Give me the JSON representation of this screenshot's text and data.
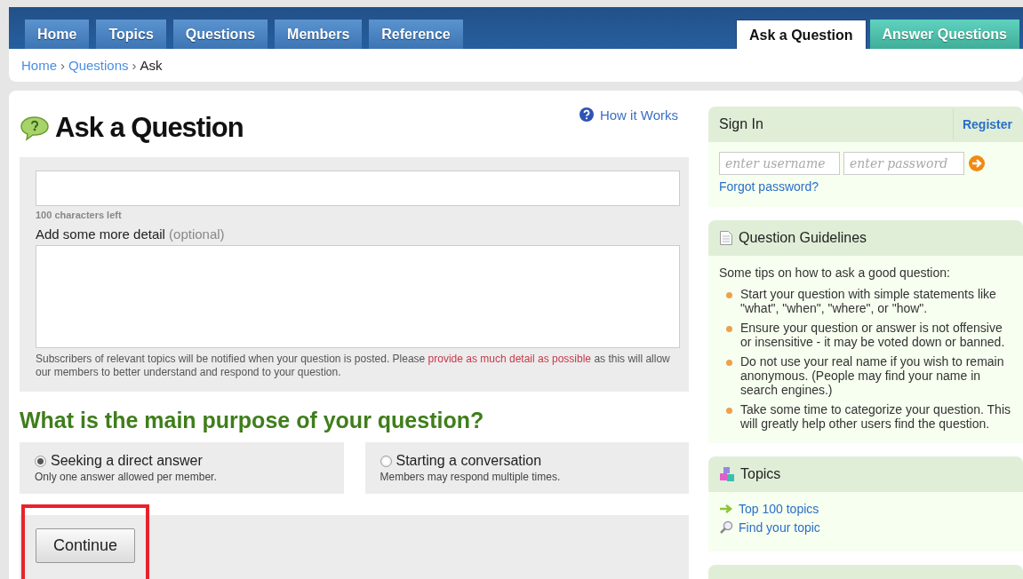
{
  "nav": {
    "tabs": [
      {
        "label": "Home"
      },
      {
        "label": "Topics"
      },
      {
        "label": "Questions"
      },
      {
        "label": "Members"
      },
      {
        "label": "Reference"
      }
    ],
    "actions": [
      {
        "label": "Ask a Question",
        "kind": "ask",
        "selected": true
      },
      {
        "label": "Answer Questions",
        "kind": "answer",
        "selected": false
      }
    ]
  },
  "breadcrumb": [
    {
      "label": "Home",
      "kind": "link"
    },
    {
      "label": "Questions",
      "kind": "link"
    },
    {
      "label": "Ask",
      "kind": "current"
    }
  ],
  "breadcrumb_separator": "›",
  "main": {
    "title": "Ask a Question",
    "help_link": "How it Works",
    "chars_left": "100 characters left",
    "detail_label": "Add some more detail",
    "detail_optional": "(optional)",
    "notice": "Subscribers of relevant topics will be notified when your question is posted. Please",
    "notice_link": "provide as much detail as possible",
    "notice_end": "as this will allow our members to better understand and respond to your question.",
    "purpose_heading": "What is the main purpose of your question?",
    "purposes": [
      {
        "label": "Seeking a direct answer",
        "hint": "Only one answer allowed per member.",
        "selected": true
      },
      {
        "label": "Starting a conversation",
        "hint": "Members may respond multiple times.",
        "selected": false
      }
    ],
    "continue_button": "Continue",
    "continue_highlighted": true
  },
  "sidebar": {
    "sign_in": {
      "title": "Sign In",
      "register": "Register",
      "username_placeholder": "enter username",
      "password_placeholder": "enter password",
      "forgot": "Forgot password?"
    },
    "guidelines": {
      "title": "Question Guidelines",
      "intro": "Some tips on how to ask a good question:",
      "tips": [
        "Start your question with simple statements like \"what\", \"when\", \"where\", or \"how\".",
        "Ensure your question or answer is not offensive or insensitive - it may be voted down or banned.",
        "Do not use your real name if you wish to remain anonymous. (People may find your name in search engines.)",
        "Take some time to categorize your question. This will greatly help other users find the question."
      ]
    },
    "topics": {
      "title": "Topics",
      "links": [
        {
          "label": "Top 100 topics",
          "kind": "arrow"
        },
        {
          "label": "Find your topic",
          "kind": "search"
        }
      ]
    }
  }
}
